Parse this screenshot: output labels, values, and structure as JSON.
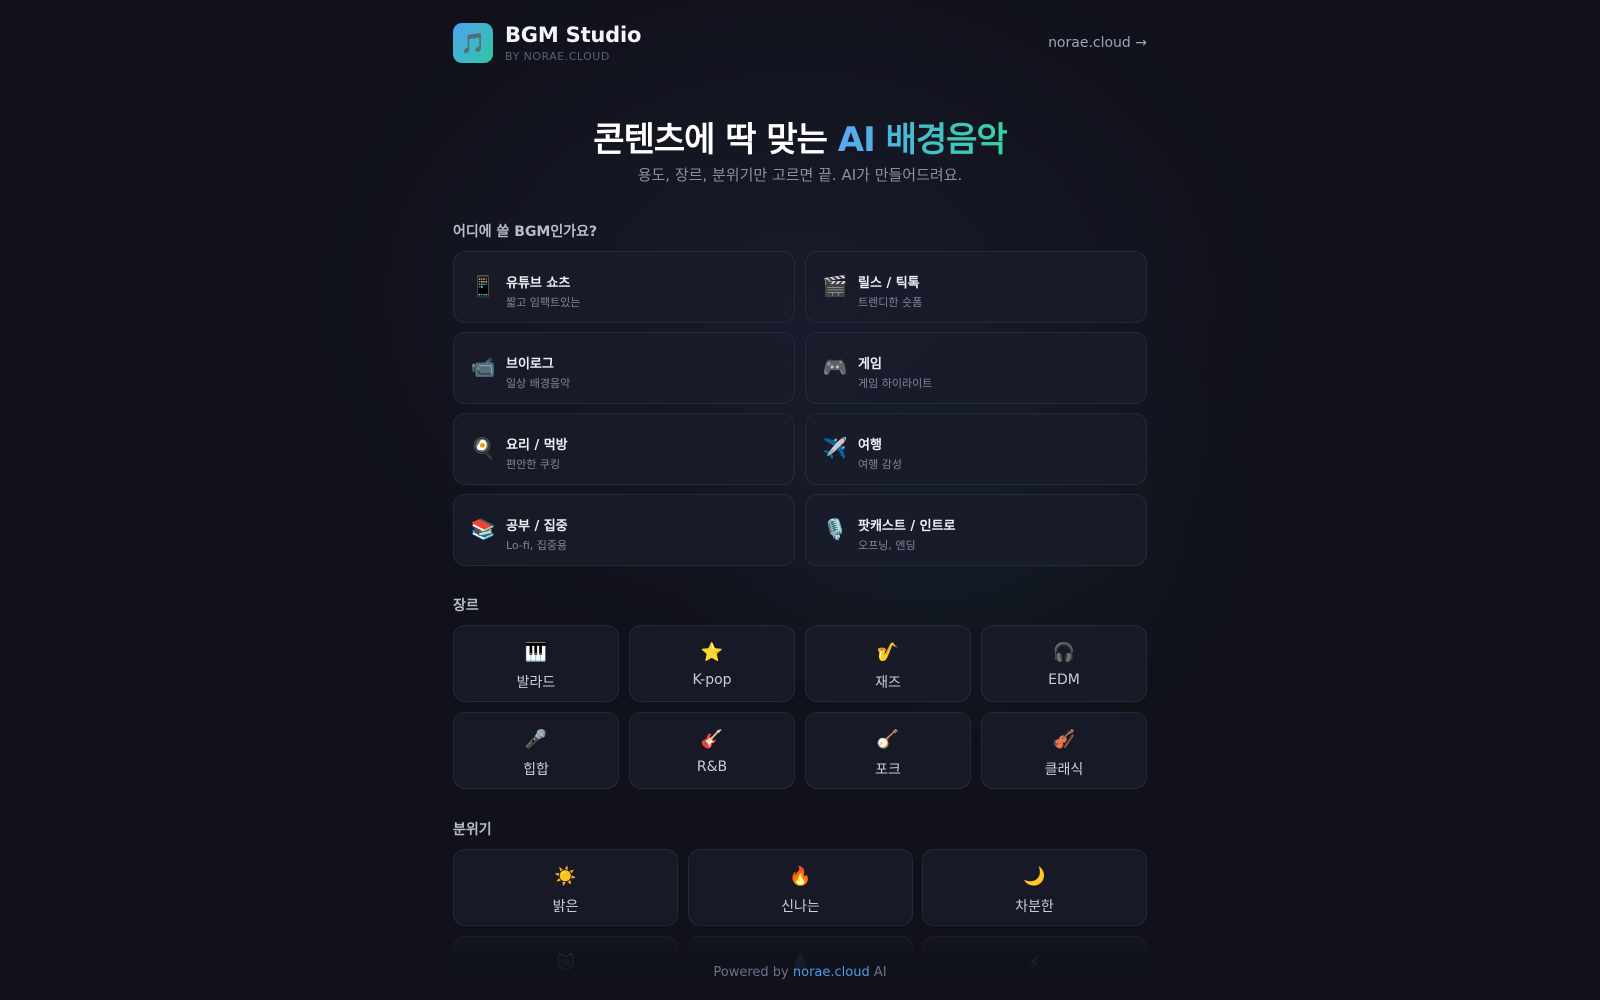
{
  "header": {
    "logo_icon": "🎵",
    "title": "BGM Studio",
    "subtitle": "BY NORAE.CLOUD",
    "link_label": "norae.cloud →"
  },
  "hero": {
    "title_lead": "콘텐츠에 딱 맞는 ",
    "title_accent": "AI 배경음악",
    "subtitle": "용도, 장르, 분위기만 고르면 끝. AI가 만들어드려요."
  },
  "usage": {
    "label": "어디에 쓸 BGM인가요?",
    "items": [
      {
        "icon": "📱",
        "title": "유튜브 쇼츠",
        "desc": "짧고 임팩트있는"
      },
      {
        "icon": "🎬",
        "title": "릴스 / 틱톡",
        "desc": "트렌디한 숏폼"
      },
      {
        "icon": "📹",
        "title": "브이로그",
        "desc": "일상 배경음악"
      },
      {
        "icon": "🎮",
        "title": "게임",
        "desc": "게임 하이라이트"
      },
      {
        "icon": "🍳",
        "title": "요리 / 먹방",
        "desc": "편안한 쿠킹"
      },
      {
        "icon": "✈️",
        "title": "여행",
        "desc": "여행 감성"
      },
      {
        "icon": "📚",
        "title": "공부 / 집중",
        "desc": "Lo-fi, 집중용"
      },
      {
        "icon": "🎙️",
        "title": "팟캐스트 / 인트로",
        "desc": "오프닝, 엔딩"
      }
    ]
  },
  "genre": {
    "label": "장르",
    "items": [
      {
        "icon": "🎹",
        "label": "발라드"
      },
      {
        "icon": "⭐",
        "label": "K-pop"
      },
      {
        "icon": "🎷",
        "label": "재즈"
      },
      {
        "icon": "🎧",
        "label": "EDM"
      },
      {
        "icon": "🎤",
        "label": "힙합"
      },
      {
        "icon": "🎸",
        "label": "R&B"
      },
      {
        "icon": "🪕",
        "label": "포크"
      },
      {
        "icon": "🎻",
        "label": "클래식"
      }
    ]
  },
  "mood": {
    "label": "분위기",
    "items": [
      {
        "icon": "☀️",
        "label": "밝은"
      },
      {
        "icon": "🔥",
        "label": "신나는"
      },
      {
        "icon": "🌙",
        "label": "차분한"
      },
      {
        "icon": "😿",
        "label": ""
      },
      {
        "icon": "💧",
        "label": ""
      },
      {
        "icon": "⚡",
        "label": ""
      }
    ]
  },
  "footer": {
    "prefix": "Powered by ",
    "link": "norae.cloud",
    "suffix": " AI"
  }
}
